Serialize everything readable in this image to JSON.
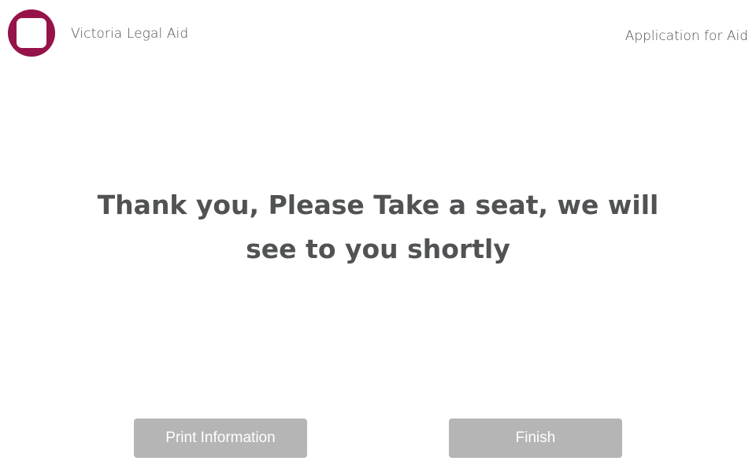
{
  "header": {
    "org_name": "Victoria Legal Aid",
    "app_title": "Application for Aid",
    "logo_color": "#96134a"
  },
  "main": {
    "message": "Thank you, Please Take a seat, we will see to you shortly"
  },
  "actions": {
    "print_label": "Print Information",
    "finish_label": "Finish",
    "button_color": "#b5b5b5"
  }
}
